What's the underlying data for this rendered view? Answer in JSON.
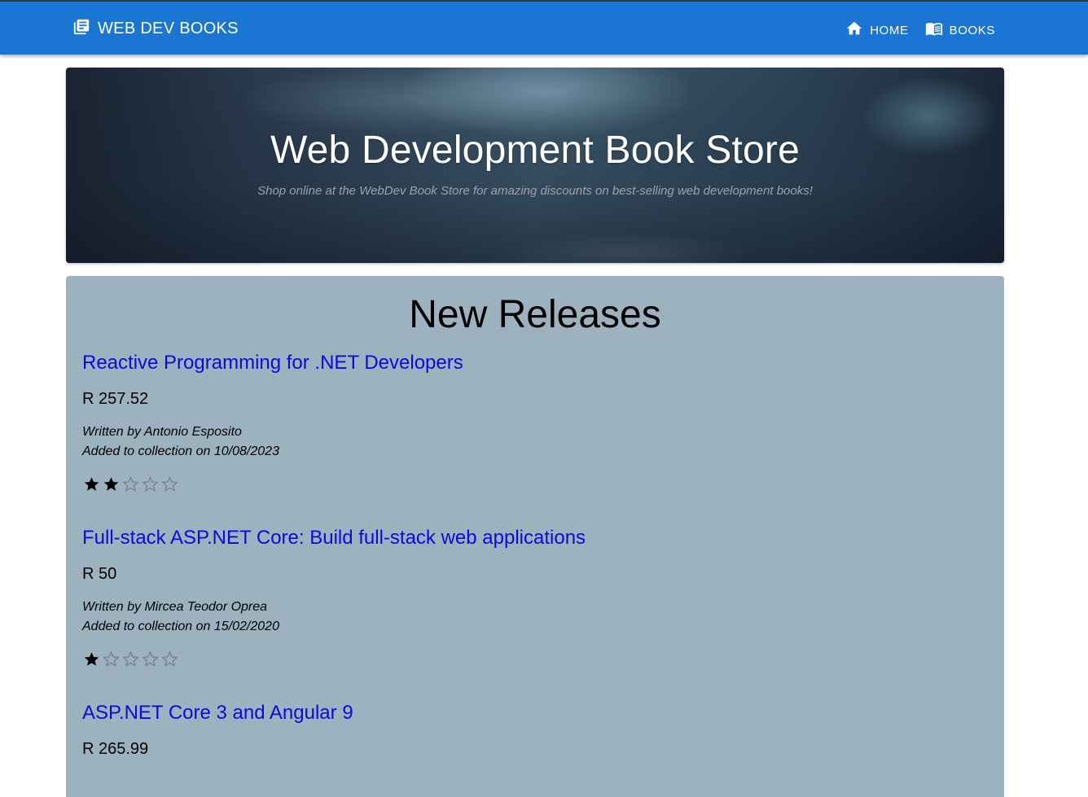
{
  "navbar": {
    "brand": "WEB DEV BOOKS",
    "brand_icon": "library-books-icon",
    "links": [
      {
        "label": "HOME",
        "icon": "home-icon"
      },
      {
        "label": "BOOKS",
        "icon": "menu-book-icon"
      }
    ],
    "color": "#1b76d3"
  },
  "hero": {
    "title": "Web Development Book Store",
    "subtitle": "Shop online at the WebDev Book Store for amazing discounts on best-selling web development books!"
  },
  "releases": {
    "title": "New Releases",
    "background": "#9db2bf",
    "books": [
      {
        "title": "Reactive Programming for .NET Developers",
        "price": "R 257.52",
        "author": "Written by Antonio Esposito",
        "added": "Added to collection on 10/08/2023",
        "rating": 2,
        "max_rating": 5
      },
      {
        "title": "Full-stack ASP.NET Core: Build full-stack web applications",
        "price": "R 50",
        "author": "Written by Mircea Teodor Oprea",
        "added": "Added to collection on 15/02/2020",
        "rating": 1,
        "max_rating": 5
      },
      {
        "title": "ASP.NET Core 3 and Angular 9",
        "price": "R 265.99"
      }
    ]
  }
}
